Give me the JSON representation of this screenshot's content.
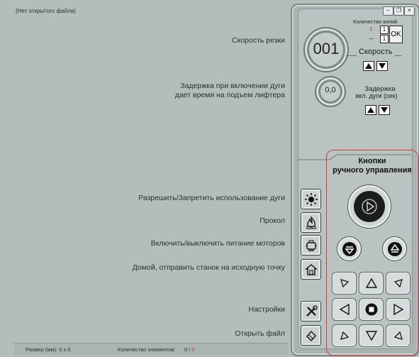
{
  "file_status": "(Нет открытого файла)",
  "descriptions": {
    "cut_speed": "Скорость резки",
    "arc_delay_1": "Задержка при включении дуги",
    "arc_delay_2": "дает время на подъем лифтера",
    "arc_enable": "Разрешить/Запретить использование дуги",
    "pierce": "Прокол",
    "motors": "Включить/выключить питание моторов",
    "home": "Домой, отправить станок на исходную точку",
    "settings": "Настройки",
    "open_file": "Открыть файл"
  },
  "panel": {
    "copies_label": "Количество копий",
    "copies_x": "1",
    "copies_y": "1",
    "ok_label": "OK",
    "speed_value": "001",
    "speed_label": "Скорость",
    "delay_value": "0,0",
    "delay_label_1": "Задержка",
    "delay_label_2": "вкл. дуги (сек)",
    "manual_title_1": "Кнопки",
    "manual_title_2": "ручного управления"
  },
  "status": {
    "size_label": "Размер (мм): 0 x 0",
    "count_label": "Количество элементов:",
    "count_value": "0",
    "count_sep": " / ",
    "count_total": "0"
  },
  "colors": {
    "background": "#b5bdbb",
    "highlight": "#d9383b",
    "count_total": "#c0392b"
  }
}
